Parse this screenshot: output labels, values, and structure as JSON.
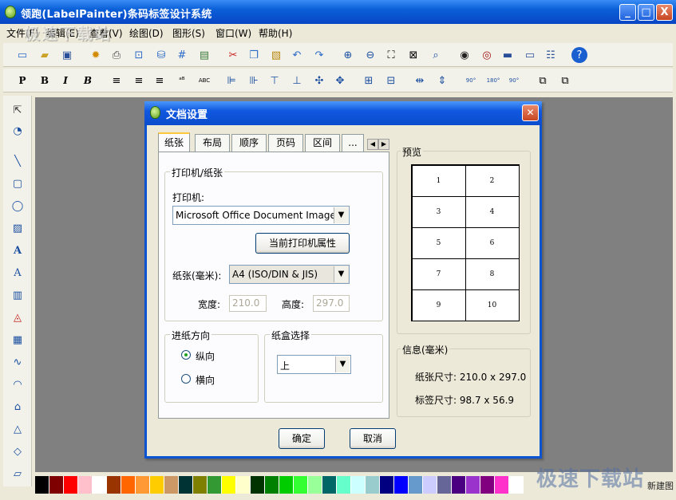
{
  "window": {
    "title": "领跑(LabelPainter)条码标签设计系统",
    "min": "_",
    "max": "□",
    "close": "X"
  },
  "menu": [
    "文件(F)",
    "编辑(E)",
    "查看(V)",
    "绘图(D)",
    "图形(S)",
    "窗口(W)",
    "帮助(H)"
  ],
  "watermark": {
    "top_left": "极速下载站",
    "bottom_right": "极速下载站"
  },
  "format_toolbar": {
    "plain": "P",
    "bold": "B",
    "italic": "I",
    "bold_italic": "B",
    "abc": "ABC",
    "rot90": "90°",
    "rot180": "180°",
    "rot270": "90°"
  },
  "status": {
    "button": "新建图"
  },
  "palette": [
    "#000000",
    "#7f0000",
    "#ff0000",
    "#ffc0cb",
    "#ffffff",
    "#993300",
    "#ff6600",
    "#ff9933",
    "#ffcc00",
    "#cc9966",
    "#003333",
    "#808000",
    "#339933",
    "#ffff00",
    "#ffffcc",
    "#003300",
    "#008000",
    "#00cc00",
    "#33ff33",
    "#99ff99",
    "#006666",
    "#66ffcc",
    "#ccffff",
    "#99cccc",
    "#000080",
    "#0000ff",
    "#6699cc",
    "#ccccff",
    "#666699",
    "#4b0082",
    "#9933cc",
    "#800080",
    "#ff33cc",
    "#ffffff"
  ],
  "dialog": {
    "title": "文档设置",
    "tabs": [
      "纸张",
      "布局",
      "顺序",
      "页码",
      "区间",
      "..."
    ],
    "printer_group": "打印机/纸张",
    "printer_label": "打印机:",
    "printer_value": "Microsoft Office Document Image ...",
    "printer_props_button": "当前打印机属性",
    "paper_label": "纸张(毫米):",
    "paper_value": "A4 (ISO/DIN & JIS)",
    "width_label": "宽度:",
    "width_value": "210.0",
    "height_label": "高度:",
    "height_value": "297.0",
    "orientation_group": "进纸方向",
    "portrait": "纵向",
    "landscape": "横向",
    "tray_group": "纸盒选择",
    "tray_value": "上",
    "preview_group": "预览",
    "preview_cells": [
      "1",
      "2",
      "3",
      "4",
      "5",
      "6",
      "7",
      "8",
      "9",
      "10"
    ],
    "info_group": "信息(毫米)",
    "paper_size": "纸张尺寸: 210.0 x 297.0",
    "label_size": "标签尺寸: 98.7 x 56.9",
    "ok": "确定",
    "cancel": "取消"
  }
}
